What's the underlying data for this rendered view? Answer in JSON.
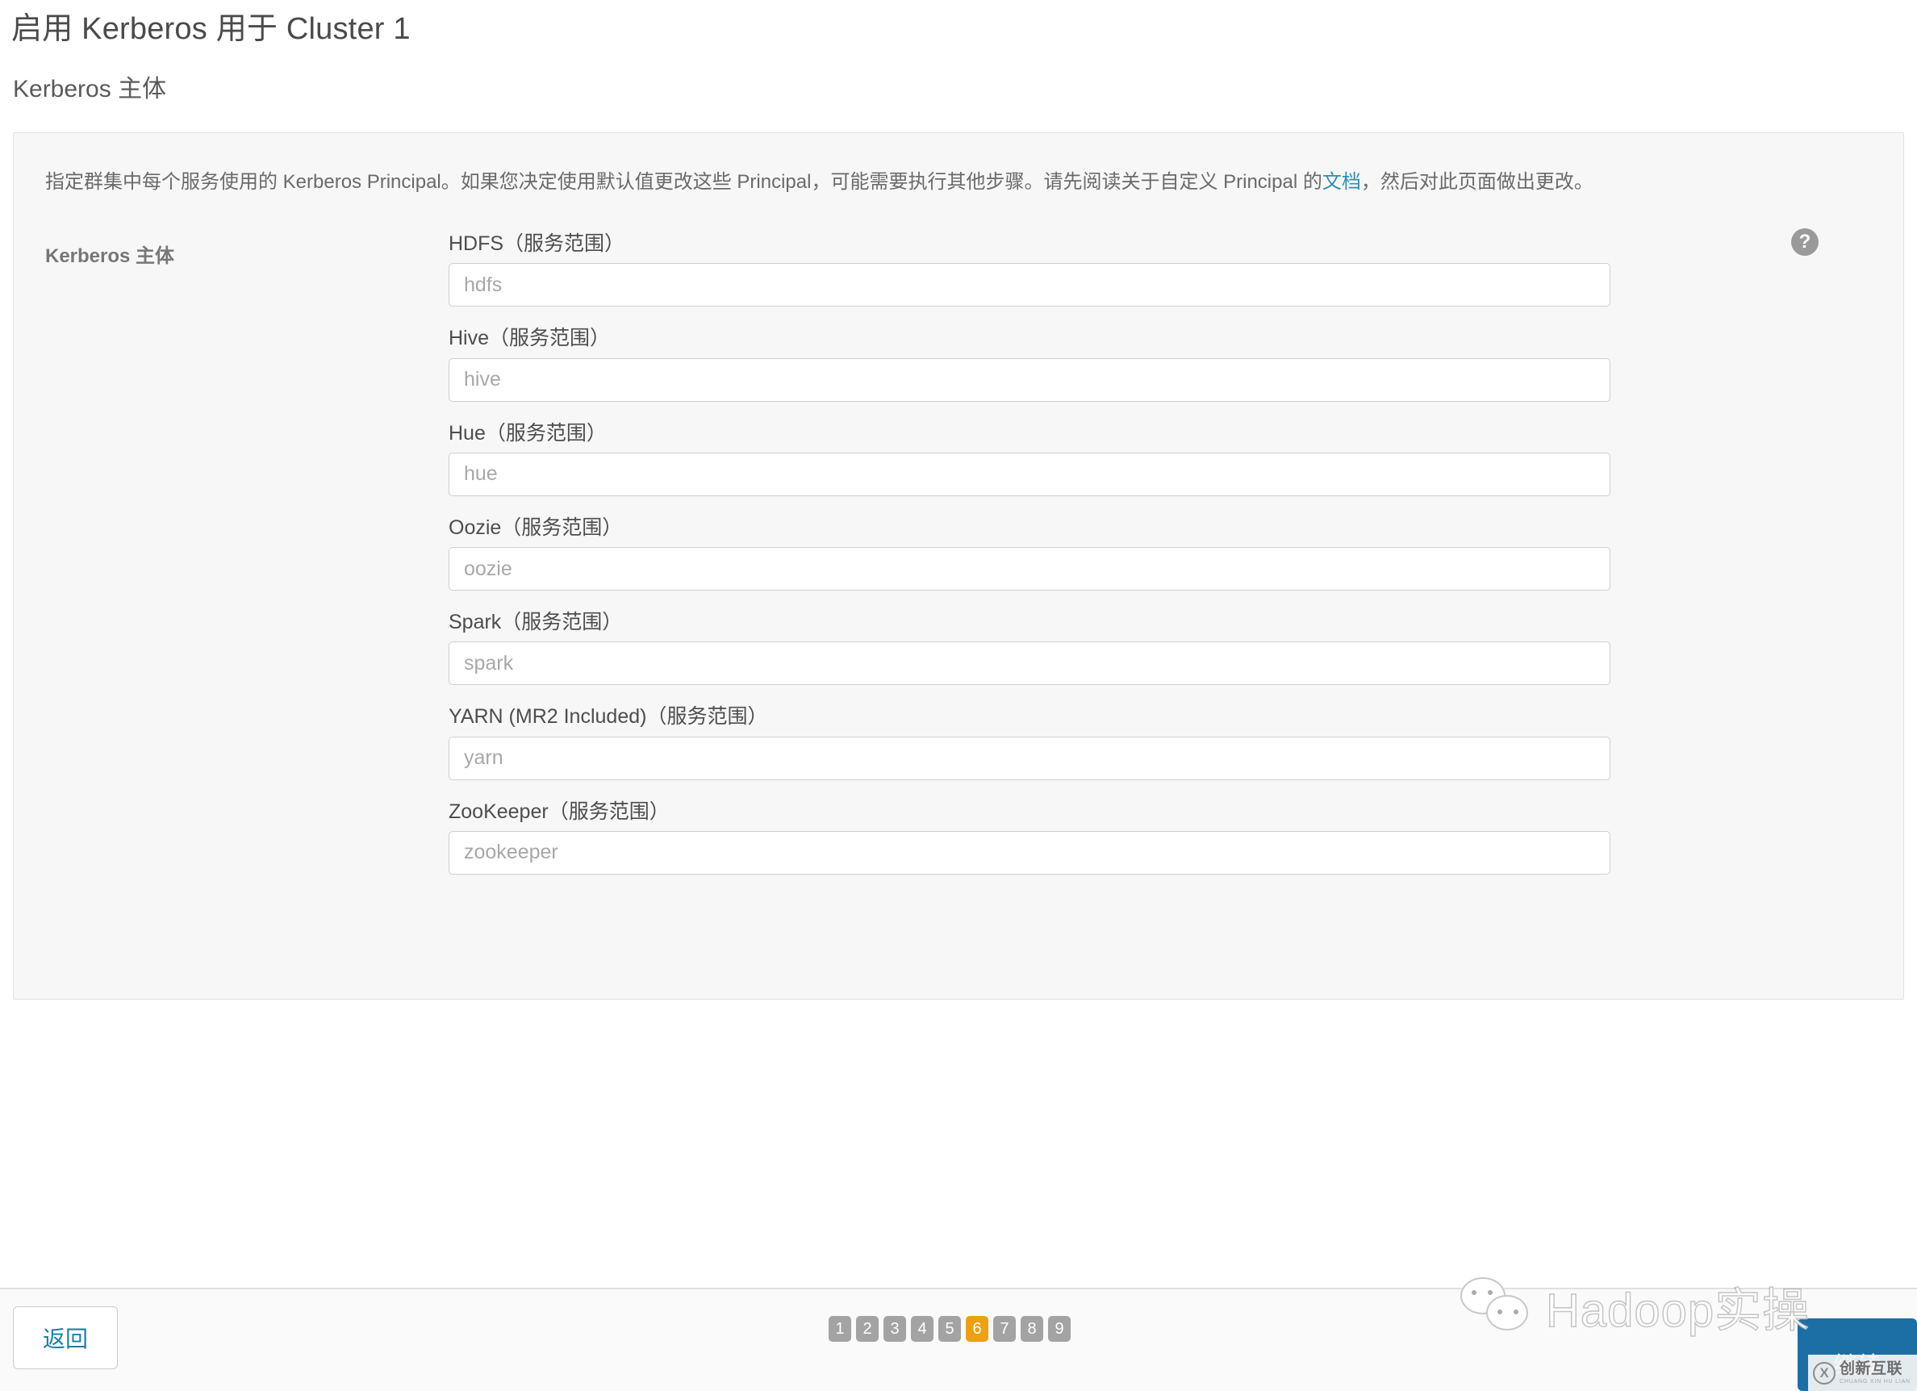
{
  "header": {
    "title": "启用 Kerberos 用于 Cluster 1",
    "subtitle": "Kerberos 主体"
  },
  "panel": {
    "description_part1": "指定群集中每个服务使用的 Kerberos Principal。如果您决定使用默认值更改这些 Principal，可能需要执行其他步骤。请先阅读关于自定义 Principal 的",
    "description_link": "文档",
    "description_part2": "，然后对此页面做出更改。",
    "section_label": "Kerberos 主体",
    "help_icon_glyph": "?",
    "fields": [
      {
        "label": "HDFS（服务范围）",
        "value": "",
        "placeholder": "hdfs"
      },
      {
        "label": "Hive（服务范围）",
        "value": "",
        "placeholder": "hive"
      },
      {
        "label": "Hue（服务范围）",
        "value": "",
        "placeholder": "hue"
      },
      {
        "label": "Oozie（服务范围）",
        "value": "",
        "placeholder": "oozie"
      },
      {
        "label": "Spark（服务范围）",
        "value": "",
        "placeholder": "spark"
      },
      {
        "label": "YARN (MR2 Included)（服务范围）",
        "value": "",
        "placeholder": "yarn"
      },
      {
        "label": "ZooKeeper（服务范围）",
        "value": "",
        "placeholder": "zookeeper"
      }
    ]
  },
  "footer": {
    "back_label": "返回",
    "continue_label": "继续",
    "pagination": {
      "steps": [
        "1",
        "2",
        "3",
        "4",
        "5",
        "6",
        "7",
        "8",
        "9"
      ],
      "active_index": 5
    }
  },
  "watermarks": {
    "hadoop_text": "Hadoop实操",
    "wechat_icon": "wechat-icon",
    "brand_main": "创新互联",
    "brand_sub": "CHUANG XIN HU LIAN",
    "brand_logo_glyph": "X"
  },
  "colors": {
    "accent_blue": "#1b6fa5",
    "link_blue": "#2d8fb3",
    "active_step_orange": "#eda012",
    "inactive_step_gray": "#a3a3a3",
    "panel_bg": "#f7f7f7"
  }
}
